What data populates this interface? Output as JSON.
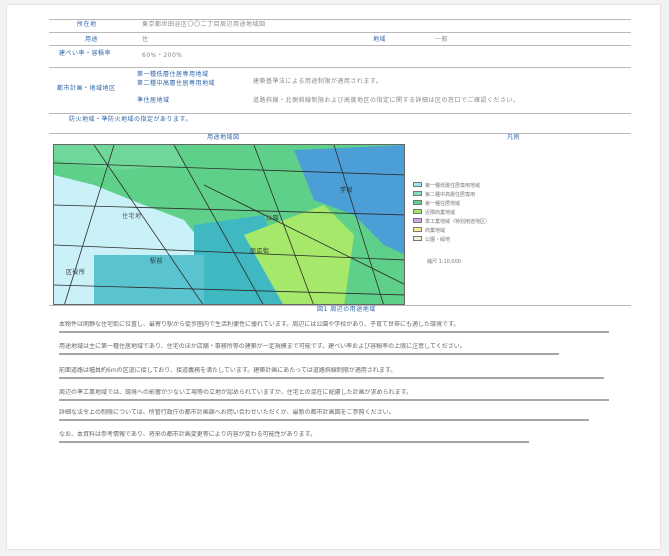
{
  "document": {
    "rows": [
      {
        "label": "所在地",
        "value": "東京都世田谷区〇〇二丁目周辺用途地域図"
      },
      {
        "label": "用途",
        "value": "住",
        "extra_label": "地域",
        "extra_value": "一般"
      },
      {
        "label": "建ぺい率・容積率",
        "value": "60%・200%"
      },
      {
        "label": "都市計画・地域地区",
        "sub": [
          "第一種低層住居専用地域",
          "第二種中高層住居専用地域",
          "準住居地域"
        ],
        "value": "建築基準法による用途制限が適用されます。"
      }
    ],
    "note": "防火地域・準防火地域の指定があります。",
    "detail": "道路斜線・北側斜線制限および高度地区の指定に関する詳細は区の窓口でご確認ください。",
    "map_caption": "用途地域図",
    "legend_caption": "凡例",
    "figure_caption": "図1 周辺の用途地域",
    "legend": [
      {
        "label": "第一種低層住居専用地域",
        "color": "#9fe6f2"
      },
      {
        "label": "第二種中高層住居専用",
        "color": "#8bd9c9"
      },
      {
        "label": "第一種住居地域",
        "color": "#5fd089"
      },
      {
        "label": "近隣商業地域",
        "color": "#a6e96a"
      },
      {
        "label": "準工業地域（特別用途地区）",
        "color": "#c9a9e8"
      },
      {
        "label": "商業地域",
        "color": "#f4ec9a"
      },
      {
        "label": "公園・緑地",
        "color": "#e8f5d0"
      }
    ],
    "legend_note": "縮尺 1:10,000",
    "map_labels": [
      "住宅地",
      "公園",
      "駅前",
      "商店街",
      "学校",
      "区役所"
    ],
    "paragraphs": [
      "本物件は閑静な住宅街に位置し、最寄り駅から徒歩圏内で生活利便性に優れています。周辺には公園や学校があり、子育て世帯にも適した環境です。",
      "用途地域は主に第一種住居地域であり、住宅のほか店舗・事務所等の建築が一定規模まで可能です。建ぺい率および容積率の上限に注意してください。",
      "前面道路は幅員約6mの区道に接しており、接道義務を満たしています。建築計画にあたっては道路斜線制限が適用されます。",
      "周辺の準工業地域では、環境への影響が少ない工場等の立地が認められていますが、住宅との混在に配慮した計画が求められます。",
      "詳細な法令上の制限については、所管行政庁の都市計画課へお問い合わせいただくか、最新の都市計画図をご参照ください。",
      "なお、本資料は参考情報であり、将来の都市計画変更等により内容が変わる可能性があります。"
    ]
  }
}
